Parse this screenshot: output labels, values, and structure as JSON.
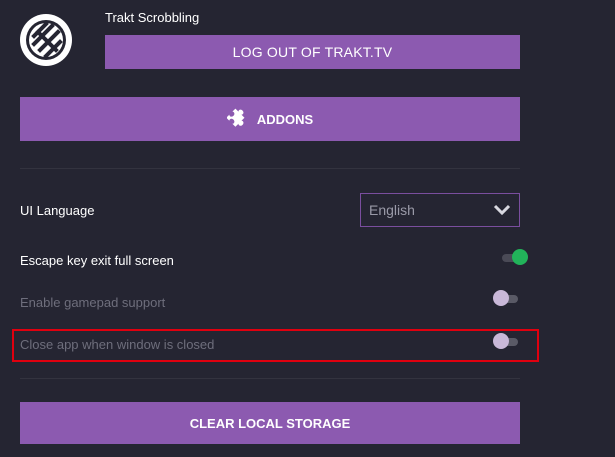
{
  "trakt": {
    "title": "Trakt Scrobbling",
    "logout_label": "LOG OUT OF TRAKT.TV",
    "logo_icon": "trakt-logo-icon"
  },
  "addons": {
    "label": "ADDONS",
    "icon": "puzzle-icon"
  },
  "settings": {
    "ui_language": {
      "label": "UI Language",
      "value": "English"
    },
    "escape_fullscreen": {
      "label": "Escape key exit full screen",
      "enabled": true
    },
    "gamepad": {
      "label": "Enable gamepad support",
      "enabled": false
    },
    "close_app": {
      "label": "Close app when window is closed",
      "enabled": false
    }
  },
  "storage": {
    "clear_label": "CLEAR LOCAL STORAGE"
  },
  "colors": {
    "background": "#252532",
    "accent": "#8c5ab0",
    "toggle_on": "#22b35a",
    "highlight": "#e0000f"
  }
}
